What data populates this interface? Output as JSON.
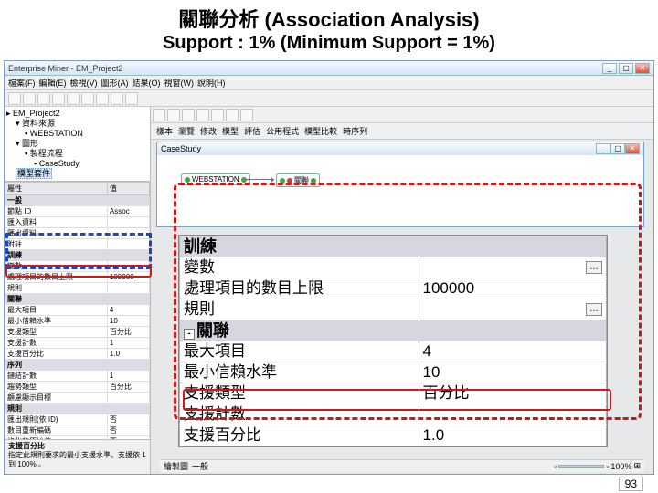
{
  "slide": {
    "title_zh": "關聯分析 (Association Analysis)",
    "subtitle": "Support : 1%  (Minimum Support = 1%)"
  },
  "app": {
    "title": "Enterprise Miner - EM_Project2",
    "menu": [
      "檔案(F)",
      "編輯(E)",
      "檢視(V)",
      "圖形(A)",
      "結果(O)",
      "視窗(W)",
      "說明(H)"
    ],
    "tree": {
      "root": "EM_Project2",
      "items": [
        "資料來源",
        "WEBSTATION",
        "圖形",
        "製程流程",
        "CaseStudy",
        "模型套件"
      ],
      "selected": "模型套件"
    },
    "prop": {
      "head_prop": "屬性",
      "head_val": "值",
      "sections": {
        "general": "一般",
        "train": "訓練",
        "assoc": "關聯",
        "seq": "序列",
        "rule": "規則"
      },
      "rows": [
        [
          "節點 ID",
          "Assoc"
        ],
        [
          "匯入資料",
          ""
        ],
        [
          "匯出資料",
          ""
        ],
        [
          "附註",
          ""
        ],
        [
          "變數",
          ""
        ],
        [
          "處理項目的數目上限",
          "100000"
        ],
        [
          "規則",
          ""
        ],
        [
          "最大項目",
          "4"
        ],
        [
          "最小信賴水準",
          "10"
        ],
        [
          "支援類型",
          "百分比"
        ],
        [
          "支援計數",
          "1"
        ],
        [
          "支援百分比",
          "1.0"
        ],
        [
          "鏈結計數",
          "1"
        ],
        [
          "趨勢類型",
          "百分比"
        ],
        [
          "顧慮顯示目標",
          ""
        ],
        [
          "匯出規則(依 ID)",
          "否"
        ],
        [
          "數目重新編碼",
          "否"
        ],
        [
          "格化的原始值",
          "否"
        ]
      ]
    },
    "propfoot": {
      "label": "支援百分比",
      "desc": "指定此規則要求的最小支援水準。支援依 1 到 100% 。"
    },
    "right_tabs": [
      "樣本",
      "瀏覽",
      "修改",
      "模型",
      "評估",
      "公用程式",
      "模型比較",
      "時序列"
    ],
    "inner_window_title": "CaseStudy",
    "nodes": {
      "src": "WEBSTATION",
      "assoc": "關聯"
    },
    "big": {
      "sect_train": "訓練",
      "row_vars": "變數",
      "row_maxitems_lbl": "處理項目的數目上限",
      "row_maxitems_val": "100000",
      "row_rules": "規則",
      "sect_assoc": "關聯",
      "row_maxit_lbl": "最大項目",
      "row_maxit_val": "4",
      "row_minconf_lbl": "最小信賴水準",
      "row_minconf_val": "10",
      "row_suptype_lbl": "支援類型",
      "row_suptype_val": "百分比",
      "row_supcnt_lbl": "支援計數",
      "row_supcnt_val": "",
      "row_suppct_lbl": "支援百分比",
      "row_suppct_val": "1.0"
    },
    "status": {
      "left_label": "繪製圖",
      "proc": "一般",
      "zoom": "100%"
    }
  },
  "page_number": "93"
}
